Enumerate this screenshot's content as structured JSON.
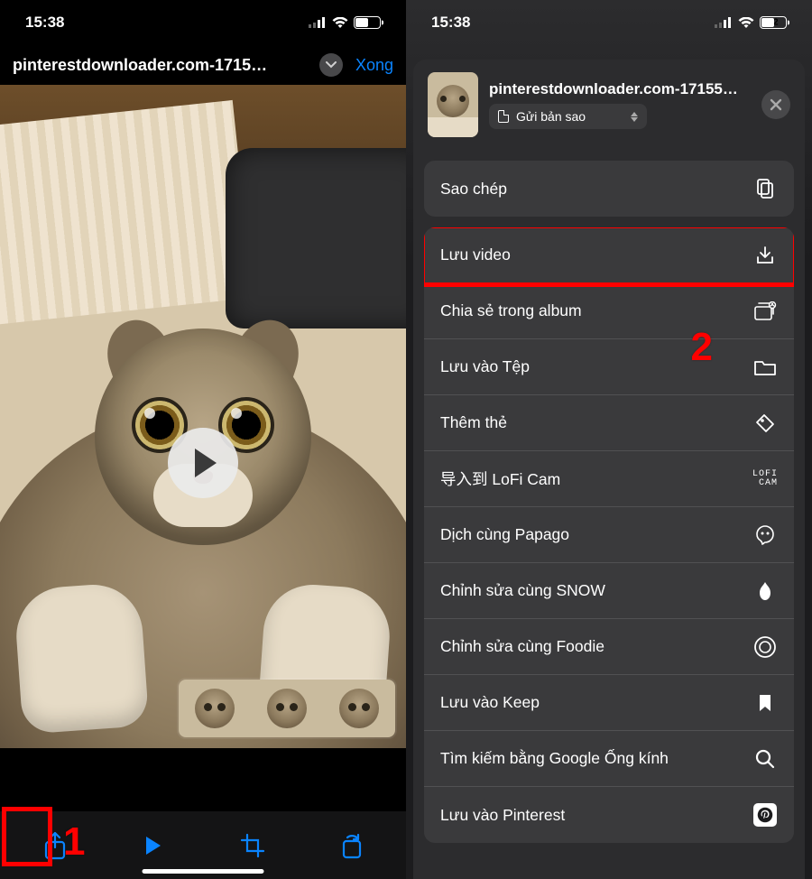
{
  "status": {
    "time": "15:38",
    "battery": "52"
  },
  "left": {
    "title": "pinterestdownloader.com-1715…",
    "done": "Xong",
    "annotation1": "1"
  },
  "sheet": {
    "title": "pinterestdownloader.com-17155…",
    "sendCopy": "Gửi bản sao",
    "annotation2": "2",
    "rows": {
      "copy": "Sao chép",
      "saveVideo": "Lưu video",
      "shareAlbum": "Chia sẻ trong album",
      "saveFiles": "Lưu vào Tệp",
      "addTags": "Thêm thẻ",
      "lofi": "导入到 LoFi Cam",
      "papago": "Dịch cùng Papago",
      "snow": "Chỉnh sửa cùng SNOW",
      "foodie": "Chỉnh sửa cùng Foodie",
      "keep": "Lưu vào Keep",
      "lens": "Tìm kiếm bằng Google Ống kính",
      "pinterest": "Lưu vào Pinterest"
    },
    "lofiIcon": "LOFI\nCAM"
  }
}
